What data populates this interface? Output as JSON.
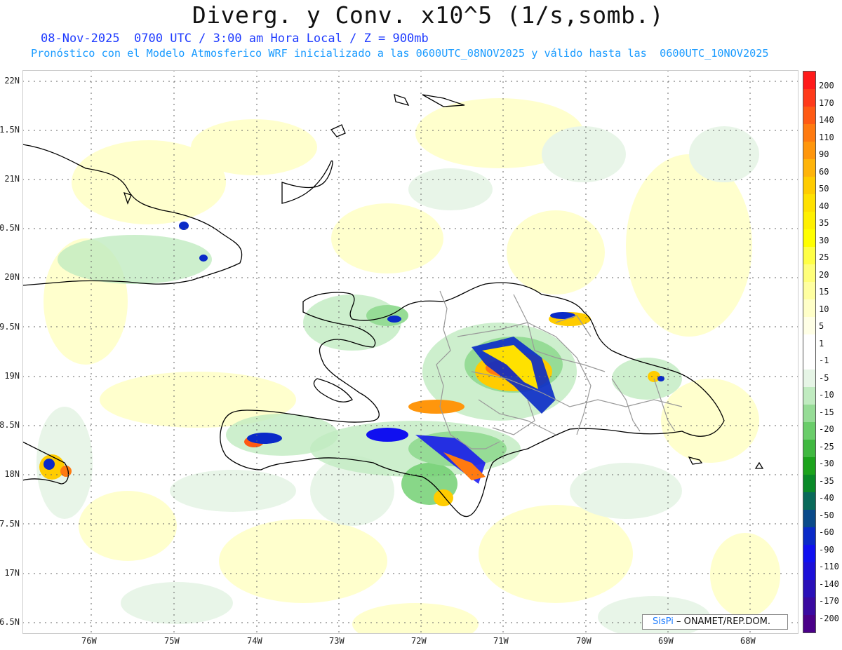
{
  "header": {
    "title": "Diverg. y Conv. x10^5 (1/s,somb.)",
    "line1": "08-Nov-2025  0700 UTC / 3:00 am Hora Local / Z = 900mb",
    "line2": "Pronóstico con el Modelo Atmosferico WRF inicializado a las 0600UTC_08NOV2025 y válido hasta las  0600UTC_10NOV2025"
  },
  "map": {
    "lat_labels": [
      "22N",
      "1.5N",
      "21N",
      "0.5N",
      "20N",
      "9.5N",
      "19N",
      "8.5N",
      "18N",
      "7.5N",
      "17N",
      "6.5N"
    ],
    "lon_labels": [
      "76W",
      "75W",
      "74W",
      "73W",
      "72W",
      "71W",
      "70W",
      "69W",
      "68W"
    ]
  },
  "legend": {
    "labels": [
      "200",
      "170",
      "140",
      "110",
      "90",
      "60",
      "50",
      "40",
      "35",
      "30",
      "25",
      "20",
      "15",
      "10",
      "5",
      "1",
      "-1",
      "-5",
      "-10",
      "-15",
      "-20",
      "-25",
      "-30",
      "-35",
      "-40",
      "-50",
      "-60",
      "-90",
      "-110",
      "-140",
      "-170",
      "-200"
    ],
    "colors": [
      "#ff1a1a",
      "#ff3a1a",
      "#ff5a14",
      "#ff7a10",
      "#ff960c",
      "#ffb40a",
      "#ffcc00",
      "#ffe100",
      "#fff000",
      "#ffff00",
      "#ffff46",
      "#ffff7a",
      "#ffffa0",
      "#ffffc8",
      "#ffffe6",
      "#ffffff",
      "#ffffff",
      "#e6f5e6",
      "#c0ebc0",
      "#96dc96",
      "#6acd6a",
      "#40b840",
      "#1ca31c",
      "#0a8a28",
      "#0a6a5a",
      "#0a4a8a",
      "#0a2ac8",
      "#1010f0",
      "#1c10d8",
      "#2a10b8",
      "#3a0aa0",
      "#4a0088"
    ]
  },
  "credit": {
    "brand": "SisPi",
    "text": "– ONAMET/REP.DOM."
  }
}
